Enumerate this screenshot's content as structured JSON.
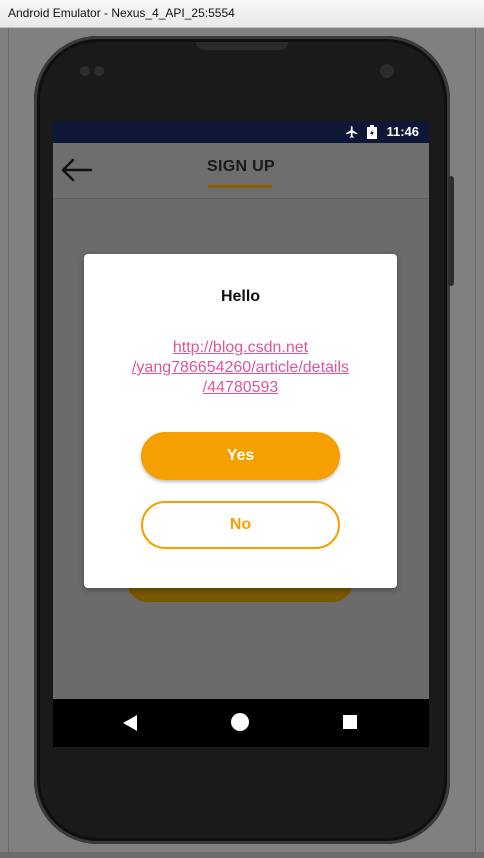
{
  "window": {
    "title": "Android Emulator - Nexus_4_API_25:5554"
  },
  "status_bar": {
    "time": "11:46",
    "icons": [
      "airplane-mode-icon",
      "battery-charging-icon"
    ]
  },
  "toolbar": {
    "title": "SIGN UP",
    "back_icon": "back-arrow-icon"
  },
  "dialog": {
    "title": "Hello",
    "link_lines": [
      "http://blog.csdn.net",
      "/yang786654260/article/details",
      "/44780593"
    ],
    "yes_label": "Yes",
    "no_label": "No"
  },
  "navigation_bar": {
    "icons": [
      "nav-back-icon",
      "nav-home-icon",
      "nav-recent-apps-icon"
    ]
  },
  "colors": {
    "accent": "#f5a000",
    "link": "#e0559a",
    "status_bar": "#0f1736",
    "scrim_background": "#6b6b6b"
  }
}
